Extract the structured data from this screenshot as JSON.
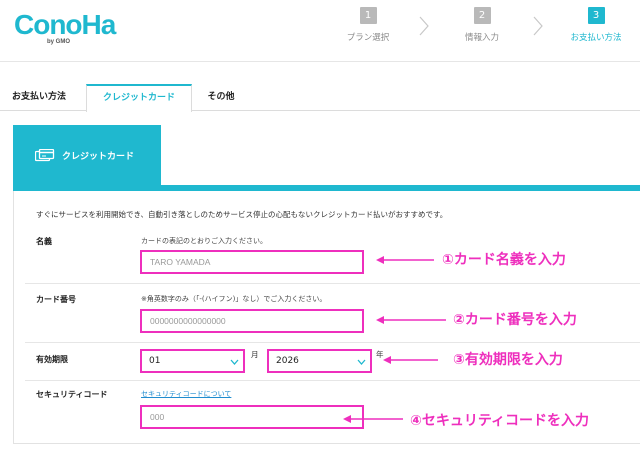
{
  "brand": {
    "name": "ConoHa",
    "sub": "by GMO"
  },
  "steps": [
    {
      "num": "1",
      "label": "プラン選択",
      "active": false
    },
    {
      "num": "2",
      "label": "情報入力",
      "active": false
    },
    {
      "num": "3",
      "label": "お支払い方法",
      "active": true
    }
  ],
  "tabs": {
    "section_label": "お支払い方法",
    "items": [
      {
        "label": "クレジットカード",
        "active": true
      },
      {
        "label": "その他",
        "active": false
      }
    ]
  },
  "method": {
    "label": "クレジットカード",
    "icon": "credit-card-icon"
  },
  "form": {
    "intro": "すぐにサービスを利用開始でき、自動引き落としのためサービス停止の心配もないクレジットカード払いがおすすめです。",
    "name": {
      "label": "名義",
      "hint": "カードの表記のとおりご入力ください。",
      "placeholder": "TARO YAMADA"
    },
    "number": {
      "label": "カード番号",
      "hint": "※角英数字のみ（「-(ハイフン)」なし）でご入力ください。",
      "placeholder": "0000000000000000"
    },
    "expiry": {
      "label": "有効期限",
      "month": "01",
      "month_unit": "月",
      "year": "2026",
      "year_unit": "年"
    },
    "security": {
      "label": "セキュリティコード",
      "link": "セキュリティコードについて",
      "placeholder": "000"
    }
  },
  "annotations": {
    "a1": "①カード名義を入力",
    "a2": "②カード番号を入力",
    "a3": "③有効期限を入力",
    "a4": "④セキュリティコードを入力"
  },
  "colors": {
    "accent": "#1fb8cf",
    "highlight": "#ee2fbd",
    "inactive_step": "#b9b9b9",
    "link": "#1f8ccf"
  }
}
